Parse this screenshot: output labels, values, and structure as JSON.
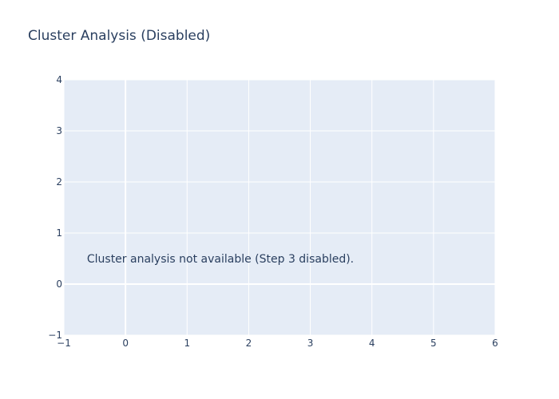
{
  "chart_data": {
    "type": "scatter",
    "title": "Cluster Analysis (Disabled)",
    "xlabel": "",
    "ylabel": "",
    "xlim": [
      -1,
      6
    ],
    "ylim": [
      -1,
      4
    ],
    "x_ticks": [
      "−1",
      "0",
      "1",
      "2",
      "3",
      "4",
      "5",
      "6"
    ],
    "y_ticks": [
      "−1",
      "0",
      "1",
      "2",
      "3",
      "4"
    ],
    "x_tick_values": [
      -1,
      0,
      1,
      2,
      3,
      4,
      5,
      6
    ],
    "y_tick_values": [
      -1,
      0,
      1,
      2,
      3,
      4
    ],
    "grid": true,
    "series": [],
    "annotation": {
      "text": "Cluster analysis not available (Step 3 disabled).",
      "x": 2.5,
      "y": 0.5
    },
    "colors": {
      "plot_bg": "#e5ecf6",
      "grid": "#ffffff",
      "text": "#2a3f5f"
    }
  }
}
